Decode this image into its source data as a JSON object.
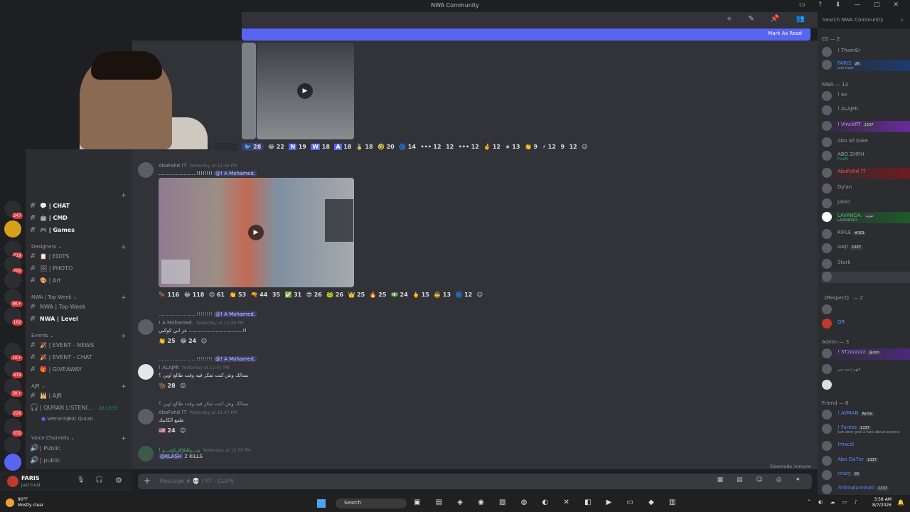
{
  "window": {
    "title": "NWA Community"
  },
  "header": {
    "search_placeholder": "Search NWA Community"
  },
  "new_messages_bar": {
    "label": "Mark As Read"
  },
  "webcam": {},
  "rail": {
    "badges": [
      "247",
      "719",
      "700",
      "9K+",
      "162",
      "1K+",
      "419",
      "3K+",
      "226",
      "532"
    ]
  },
  "sidebar": {
    "channels_top": [
      {
        "label": "| CHAT",
        "icon": "💬"
      },
      {
        "label": "| CMD",
        "icon": "🤖"
      },
      {
        "label": "| Games",
        "icon": "🎮"
      }
    ],
    "categories": {
      "designers": "Designers",
      "top_week": "NWA | Top Week",
      "events": "Events",
      "ajr": "AJR",
      "voice": "Voice Channels"
    },
    "designer_channels": [
      {
        "label": "| EDITS",
        "icon": "📋"
      },
      {
        "label": "| PHOTO",
        "icon": "🖼"
      },
      {
        "label": "| Art",
        "icon": "🎨"
      }
    ],
    "top_week_channels": [
      {
        "label": "NWA | Top-Week"
      },
      {
        "label": "NWA | Level"
      }
    ],
    "event_channels": [
      {
        "label": "| EVENT - NEWS",
        "icon": "🎉"
      },
      {
        "label": "| EVENT - CHAT",
        "icon": "🎉"
      },
      {
        "label": "| GIVEAWAY",
        "icon": "🎁"
      }
    ],
    "ajr_channels": [
      {
        "label": "| AJR",
        "icon": "🕌"
      },
      {
        "label": "| QURAN LISTENI...",
        "time": "22:13:53"
      },
      {
        "label": "VetroniqBot Quran"
      }
    ],
    "voice_channels": [
      {
        "label": "| Public"
      },
      {
        "label": "| public"
      }
    ]
  },
  "user": {
    "name": "FARIS",
    "status": "just trust"
  },
  "messages": {
    "top_reactions": [
      {
        "emoji": "🐦",
        "count": "28"
      },
      {
        "emoji": "😂",
        "count": "22"
      },
      {
        "emoji": "N",
        "count": "19"
      },
      {
        "emoji": "W",
        "count": "18"
      },
      {
        "emoji": "A",
        "count": "18"
      },
      {
        "emoji": "🥇",
        "count": "18"
      },
      {
        "emoji": "🤣",
        "count": "20"
      },
      {
        "emoji": "🌀",
        "count": "14"
      },
      {
        "emoji": "•••",
        "count": "12"
      },
      {
        "emoji": "",
        "count": "12"
      },
      {
        "emoji": "•••",
        "count": "12"
      },
      {
        "emoji": "🤞",
        "count": "12"
      },
      {
        "emoji": "★",
        "count": "13"
      },
      {
        "emoji": "👏",
        "count": "9"
      },
      {
        "emoji": "⚡",
        "count": "12"
      },
      {
        "emoji": "",
        "count": "9"
      },
      {
        "emoji": "",
        "count": "12"
      }
    ],
    "post1": {
      "author": "AboFahd !T",
      "time": "Yesterday at 12:46 PM",
      "text": "........................!!!!!!!!",
      "mention": "@! A Mohamed.",
      "reactions": [
        {
          "emoji": "🐂",
          "count": "116"
        },
        {
          "emoji": "😂",
          "count": "118"
        },
        {
          "emoji": "😍",
          "count": "61"
        },
        {
          "emoji": "👏",
          "count": "53"
        },
        {
          "emoji": "🔫",
          "count": "44"
        },
        {
          "emoji": "",
          "count": "35"
        },
        {
          "emoji": "✅",
          "count": "31"
        },
        {
          "emoji": "😎",
          "count": "26"
        },
        {
          "emoji": "🐸",
          "count": "26"
        },
        {
          "emoji": "👑",
          "count": "25"
        },
        {
          "emoji": "🔥",
          "count": "25"
        },
        {
          "emoji": "💵",
          "count": "24"
        },
        {
          "emoji": "🖕",
          "count": "15"
        },
        {
          "emoji": "🤠",
          "count": "13"
        },
        {
          "emoji": "🌀",
          "count": "12"
        }
      ]
    },
    "post2": {
      "reply_preview": "........................!!!!!!!!",
      "reply_mention": "@! A Mohamed.",
      "author": "! A Mohamed.",
      "time": "Yesterday at 12:46 PM",
      "text": "عز ابي كوكبي ..................................!!",
      "reactions": [
        {
          "emoji": "👏",
          "count": "25"
        },
        {
          "emoji": "😂",
          "count": "24"
        }
      ]
    },
    "post3": {
      "reply_preview": "........................!!!!!!!!",
      "reply_mention": "@! A Mohamed.",
      "author": "! ALAJMI",
      "time": "Yesterday at 12:47 PM",
      "text": "بسالك وش كنت تفكر فيه وقت طالع اوين ؟",
      "reactions": [
        {
          "emoji": "🦬",
          "count": "28"
        }
      ]
    },
    "post4": {
      "reply_preview": "بسالك وش كنت تفكر فيه وقت طالع اوين ؟",
      "author": "AboFahd !T",
      "time": "Yesterday at 12:47 PM",
      "text": "طمع الكابيك",
      "reactions": [
        {
          "emoji": "🇺🇸",
          "count": "24"
        }
      ]
    },
    "post5": {
      "author": "! ﷽",
      "time": "Yesterday at 12:50 PM",
      "mention": "@KLASH",
      "text": "2 KILLS"
    }
  },
  "composer": {
    "placeholder": "Message # 💀 | RT - CLIPS"
  },
  "slowmode": "Slowmode immune",
  "members": {
    "groups": [
      {
        "label": "C0 — 2",
        "items": [
          {
            "name": "! ThamEr",
            "sub": ""
          },
          {
            "name": "FARIS",
            "sub": "just trust",
            "badge": "2K"
          }
        ]
      },
      {
        "label": "NWA — 13",
        "items": [
          {
            "name": "! ex",
            "sub": ""
          },
          {
            "name": "! ALAJMI",
            "sub": ""
          },
          {
            "name": "! VinckRT",
            "sub": "",
            "badge": "1337"
          },
          {
            "name": "Abo all bake",
            "sub": ""
          },
          {
            "name": "ABO ZHRH",
            "sub": "FluxM"
          },
          {
            "name": "AboFahd !T",
            "sub": ""
          },
          {
            "name": "Dylan",
            "sub": ""
          },
          {
            "name": "Jaber",
            "sub": ""
          },
          {
            "name": "LAVANDA.",
            "sub": "LAVANDAD",
            "badge": "عرب"
          },
          {
            "name": "RIFLE",
            "sub": "",
            "badge": "#101"
          },
          {
            "name": "saqr",
            "sub": "",
            "badge": "1337"
          },
          {
            "name": "Sturk",
            "sub": ""
          }
        ]
      },
      {
        "label": "《Respect》 — 2",
        "items": [
          {
            "name": "QR",
            "sub": ""
          }
        ]
      },
      {
        "label": "Admin — 3",
        "items": [
          {
            "name": "! 3Tzzzzzzz",
            "sub": "",
            "badge": "@ooo"
          },
          {
            "name": "",
            "sub": "اللهم ارحم حبي"
          }
        ]
      },
      {
        "label": "Friend — 6",
        "items": [
          {
            "name": "! AYMAN",
            "sub": "",
            "badge": "Ayme"
          },
          {
            "name": "! Faress",
            "sub": "Just dont give a fuck about anyone",
            "badge": "1337"
          },
          {
            "name": "!mxcsl",
            "sub": ""
          },
          {
            "name": "Abo Da7er",
            "sub": "",
            "badge": "1337"
          },
          {
            "name": "crazy",
            "sub": "",
            "badge": "2K"
          },
          {
            "name": "Trillmaluminati",
            "sub": "",
            "badge": "1337"
          }
        ]
      }
    ]
  },
  "taskbar": {
    "weather_temp": "90°F",
    "weather_text": "Mostly clear",
    "search": "Search",
    "time": "3:58 AM",
    "date": "8/7/2026"
  }
}
